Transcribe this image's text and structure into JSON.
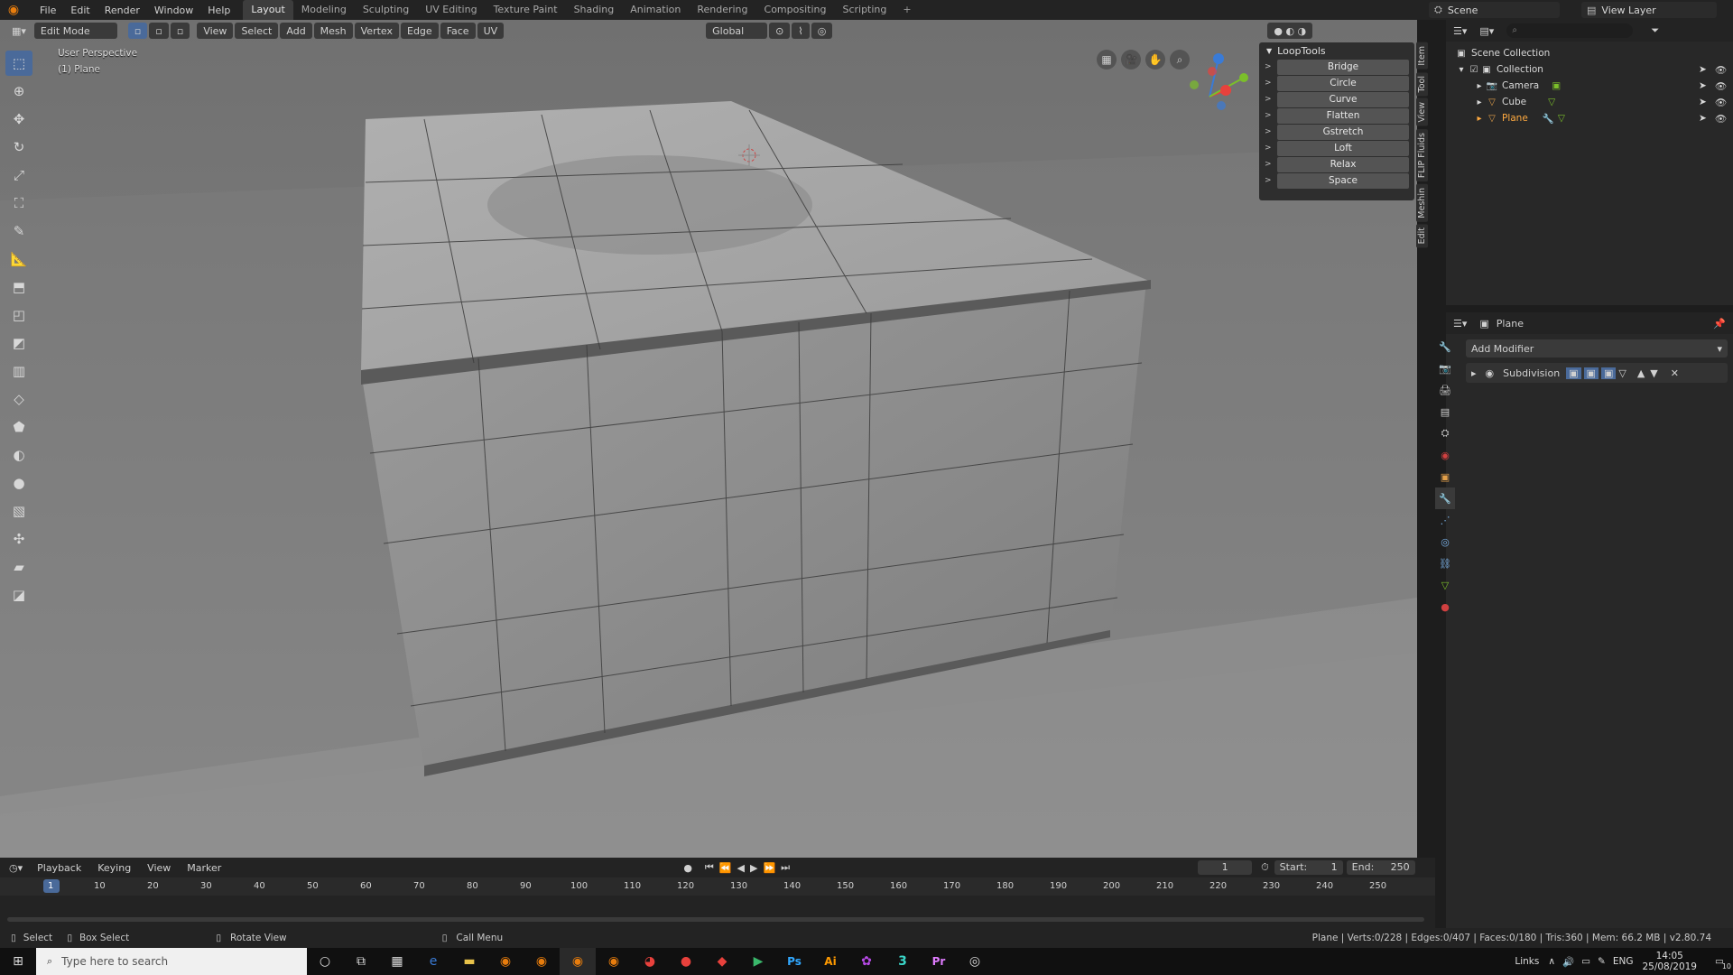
{
  "topbar": {
    "menus": [
      "File",
      "Edit",
      "Render",
      "Window",
      "Help"
    ],
    "workspaces": [
      "Layout",
      "Modeling",
      "Sculpting",
      "UV Editing",
      "Texture Paint",
      "Shading",
      "Animation",
      "Rendering",
      "Compositing",
      "Scripting"
    ],
    "active_workspace": "Layout",
    "scene": "Scene",
    "view_layer": "View Layer"
  },
  "viewport_header": {
    "mode": "Edit Mode",
    "menus": [
      "View",
      "Select",
      "Add",
      "Mesh",
      "Vertex",
      "Edge",
      "Face",
      "UV"
    ],
    "orientation": "Global"
  },
  "viewport": {
    "perspective": "User Perspective",
    "object": "(1) Plane"
  },
  "looptools": {
    "title": "LoopTools",
    "items": [
      "Bridge",
      "Circle",
      "Curve",
      "Flatten",
      "Gstretch",
      "Loft",
      "Relax",
      "Space"
    ]
  },
  "side_tabs": [
    "Item",
    "Tool",
    "View",
    "FLIP Fluids",
    "Meshin",
    "Edit"
  ],
  "outliner": {
    "scene_collection": "Scene Collection",
    "collection": "Collection",
    "objects": [
      {
        "name": "Camera",
        "icon": "camera-icon"
      },
      {
        "name": "Cube",
        "icon": "mesh-icon"
      },
      {
        "name": "Plane",
        "icon": "mesh-icon",
        "selected": true
      }
    ]
  },
  "properties": {
    "object_name": "Plane",
    "add_modifier": "Add Modifier",
    "modifier_name": "Subdivision"
  },
  "timeline": {
    "menus": [
      "Playback",
      "Keying",
      "View",
      "Marker"
    ],
    "current_frame": "1",
    "start_label": "Start:",
    "start": "1",
    "end_label": "End:",
    "end": "250",
    "ticks": [
      "1",
      "10",
      "20",
      "30",
      "40",
      "50",
      "60",
      "70",
      "80",
      "90",
      "100",
      "110",
      "120",
      "130",
      "140",
      "150",
      "160",
      "170",
      "180",
      "190",
      "200",
      "210",
      "220",
      "230",
      "240",
      "250"
    ]
  },
  "statusbar": {
    "select": "Select",
    "box_select": "Box Select",
    "rotate_view": "Rotate View",
    "call_menu": "Call Menu",
    "stats": "Plane | Verts:0/228 | Edges:0/407 | Faces:0/180 | Tris:360 | Mem: 66.2 MB | v2.80.74"
  },
  "taskbar": {
    "search_placeholder": "Type here to search",
    "links": "Links",
    "lang": "ENG",
    "time": "14:05",
    "date": "25/08/2019",
    "notification_count": "10"
  },
  "colors": {
    "accent_blue": "#4a6a9a",
    "selected_orange": "#ffaa40",
    "x_axis": "#e8413c",
    "y_axis": "#7bbf2a",
    "z_axis": "#3a7bd6"
  }
}
